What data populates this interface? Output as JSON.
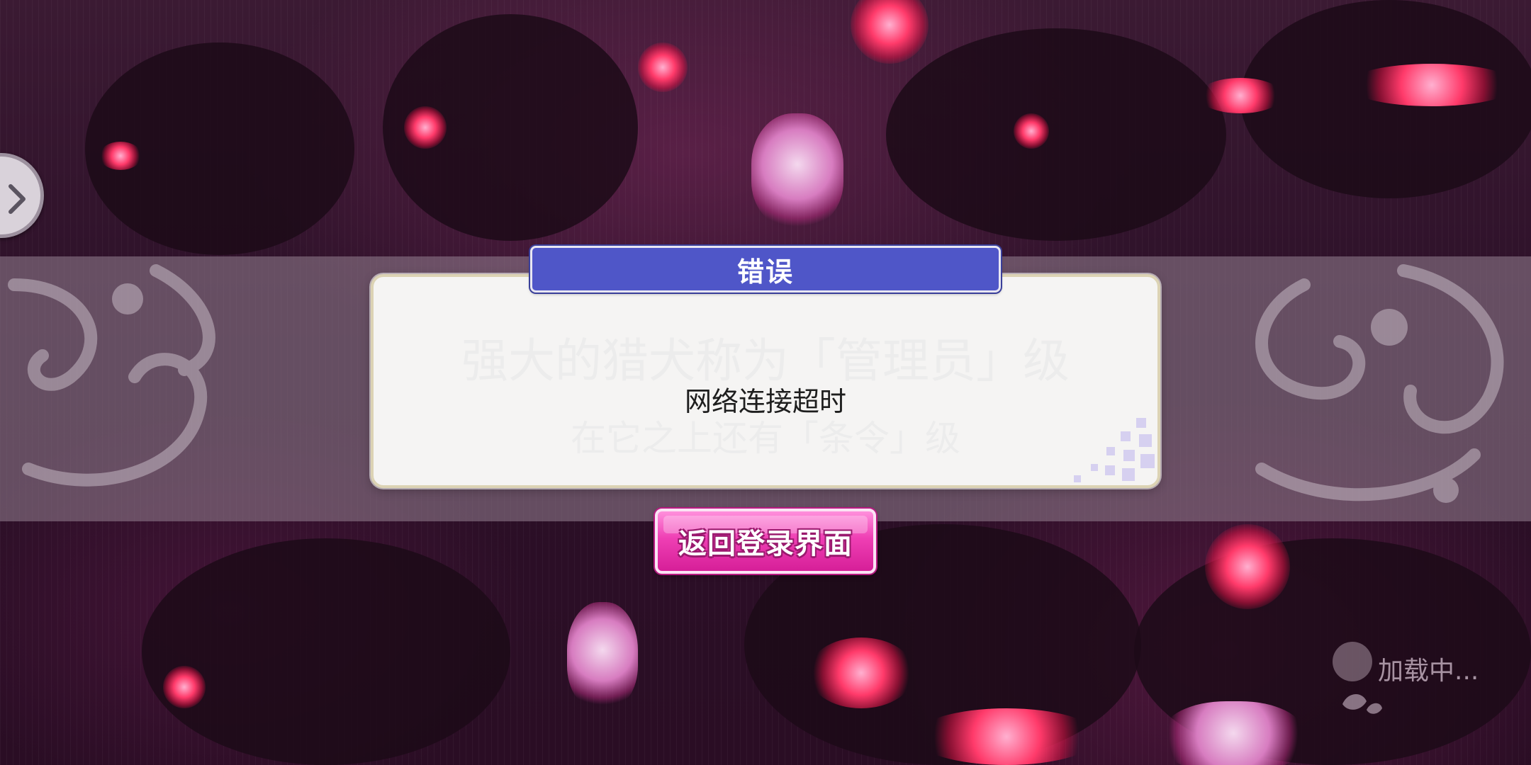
{
  "dialog": {
    "title": "错误",
    "message": "网络连接超时",
    "background_text_line1": "强大的猎犬称为「管理员」级",
    "background_text_line2": "在它之上还有「条令」级"
  },
  "actions": {
    "back_to_login_label": "返回登录界面"
  },
  "loading": {
    "text": "加载中..."
  },
  "side_button": {
    "icon": "chevron-right-icon"
  },
  "colors": {
    "title_bar": "#4f56c8",
    "button_pink": "#ef3fb4",
    "background": "#2a0f22"
  }
}
